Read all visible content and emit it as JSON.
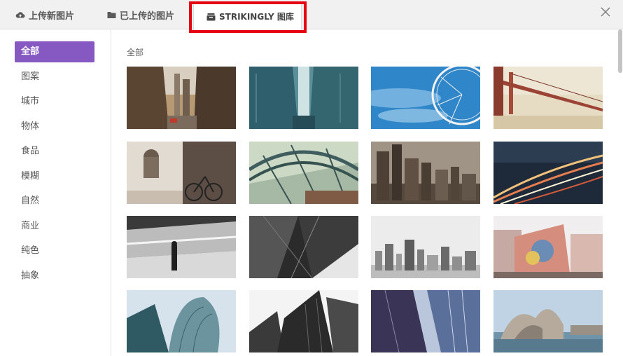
{
  "tabs": {
    "upload_label": "上传新图片",
    "uploaded_label": "已上传的图片",
    "gallery_label": "STRIKINGLY 图库"
  },
  "sidebar": {
    "items": [
      {
        "label": "全部",
        "active": true
      },
      {
        "label": "图案",
        "active": false
      },
      {
        "label": "城市",
        "active": false
      },
      {
        "label": "物体",
        "active": false
      },
      {
        "label": "食品",
        "active": false
      },
      {
        "label": "模糊",
        "active": false
      },
      {
        "label": "自然",
        "active": false
      },
      {
        "label": "商业",
        "active": false
      },
      {
        "label": "纯色",
        "active": false
      },
      {
        "label": "抽象",
        "active": false
      }
    ]
  },
  "gallery": {
    "section_title": "全部"
  },
  "colors": {
    "accent": "#8559c1",
    "highlight": "#e60012",
    "tab_bar_bg": "#f1f1f1"
  }
}
